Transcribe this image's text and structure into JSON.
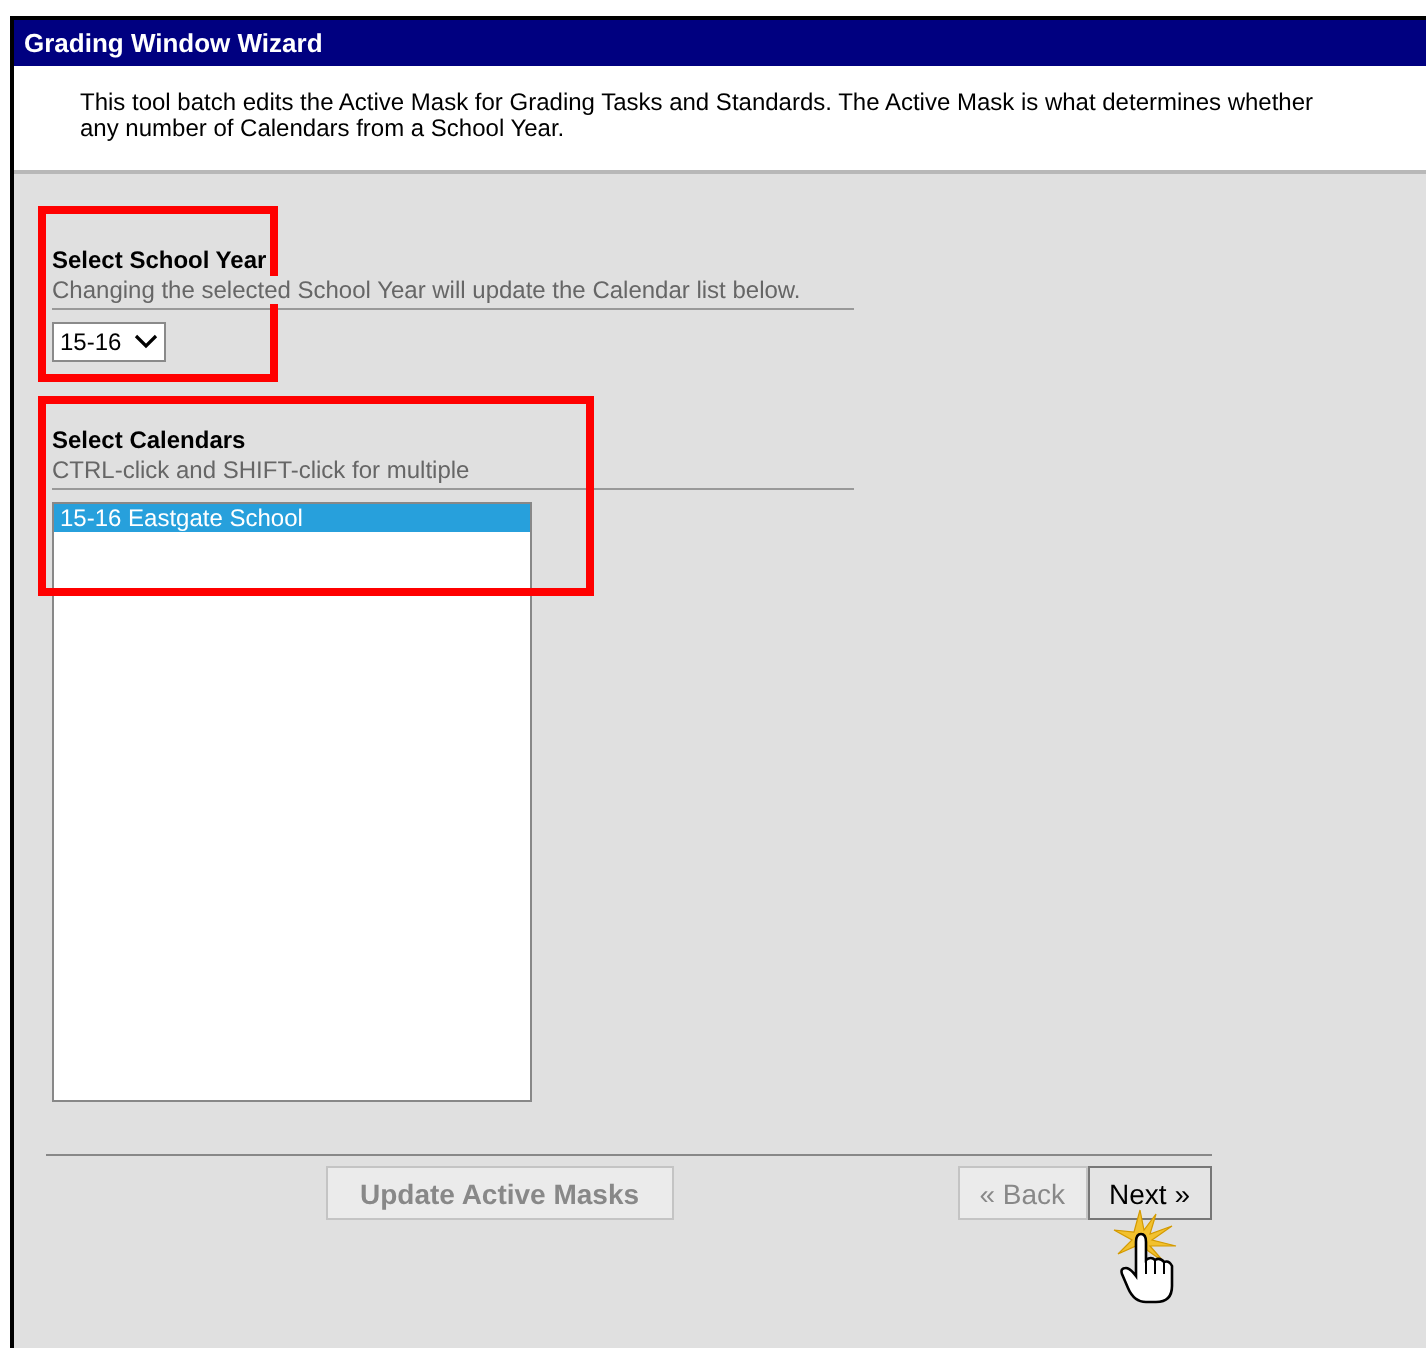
{
  "window": {
    "title": "Grading Window Wizard"
  },
  "intro": {
    "lines": [
      "This tool batch edits the Active Mask for Grading Tasks and Standards. The Active Mask is what determines whether",
      "any number of Calendars from a School Year."
    ]
  },
  "school_year": {
    "label": "Select School Year",
    "hint": "Changing the selected School Year will update the Calendar list below.",
    "value": "15-16",
    "highlighted": true
  },
  "calendars": {
    "label": "Select Calendars",
    "hint": "CTRL-click and SHIFT-click for multiple",
    "highlighted": true,
    "items": [
      {
        "label": "15-16 Eastgate School",
        "selected": true
      }
    ]
  },
  "buttons": [
    {
      "label": "Update Active Masks",
      "kind": "action",
      "disabled": true
    },
    {
      "label": "« Back",
      "kind": "nav",
      "disabled": true
    },
    {
      "label": "Next »",
      "kind": "nav",
      "disabled": false,
      "clicked": true
    }
  ]
}
